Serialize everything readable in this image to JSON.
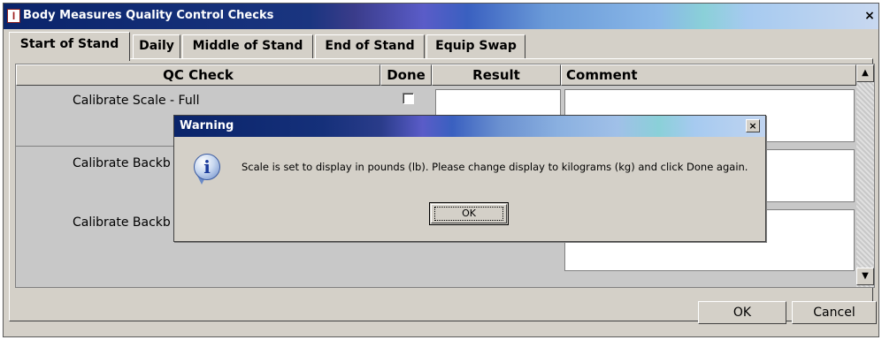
{
  "window": {
    "title": "Body Measures Quality Control Checks",
    "close_glyph": "×",
    "icon": "app-icon"
  },
  "tabs": [
    {
      "label": "Start of Stand",
      "active": true
    },
    {
      "label": "Daily",
      "active": false
    },
    {
      "label": "Middle of Stand",
      "active": false
    },
    {
      "label": "End of Stand",
      "active": false
    },
    {
      "label": "Equip Swap",
      "active": false
    }
  ],
  "grid": {
    "columns": [
      "QC Check",
      "Done",
      "Result",
      "Comment"
    ],
    "rows": [
      {
        "check": "Calibrate Scale - Full",
        "done": false,
        "result": "",
        "comment": ""
      },
      {
        "check": "Calibrate Backb",
        "done": false,
        "result": "",
        "comment": ""
      },
      {
        "check": "Calibrate Backb",
        "done": false,
        "result": "",
        "comment": ""
      }
    ],
    "scroll_up_glyph": "▲",
    "scroll_down_glyph": "▼"
  },
  "footer": {
    "ok_label": "OK",
    "cancel_label": "Cancel"
  },
  "dialog": {
    "title": "Warning",
    "close_glyph": "×",
    "icon": "info-icon",
    "icon_glyph": "i",
    "message": "Scale is set to display in pounds (lb).  Please change display to kilograms (kg) and click Done again.",
    "ok_label": "OK"
  }
}
